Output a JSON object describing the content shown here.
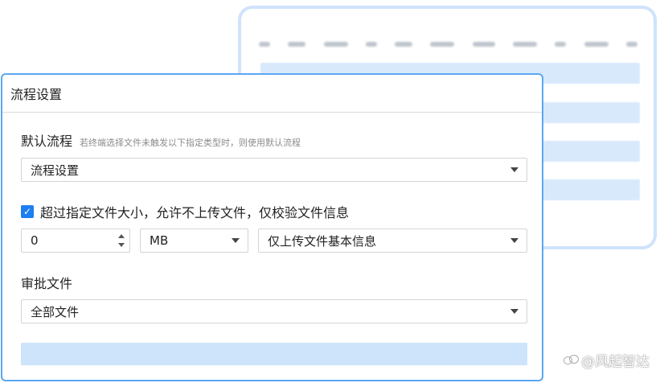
{
  "background_card": {
    "header_count": 11,
    "row_count": 4
  },
  "dialog": {
    "title": "流程设置",
    "default_flow": {
      "label": "默认流程",
      "hint": "若终端选择文件未触发以下指定类型时，则使用默认流程",
      "selected": "流程设置"
    },
    "size_limit": {
      "checked": true,
      "label": "超过指定文件大小，允许不上传文件，仅校验文件信息",
      "size_value": "0",
      "unit_selected": "MB",
      "mode_selected": "仅上传文件基本信息"
    },
    "approval_files": {
      "label": "审批文件",
      "selected": "全部文件"
    }
  },
  "watermark": {
    "text": "@风起智达"
  },
  "colors": {
    "accent": "#1e7ff0",
    "dialog_border": "#5aa6f2",
    "bottom_bar": "#cde4fb",
    "bg_card_border": "#cfe3fb"
  }
}
